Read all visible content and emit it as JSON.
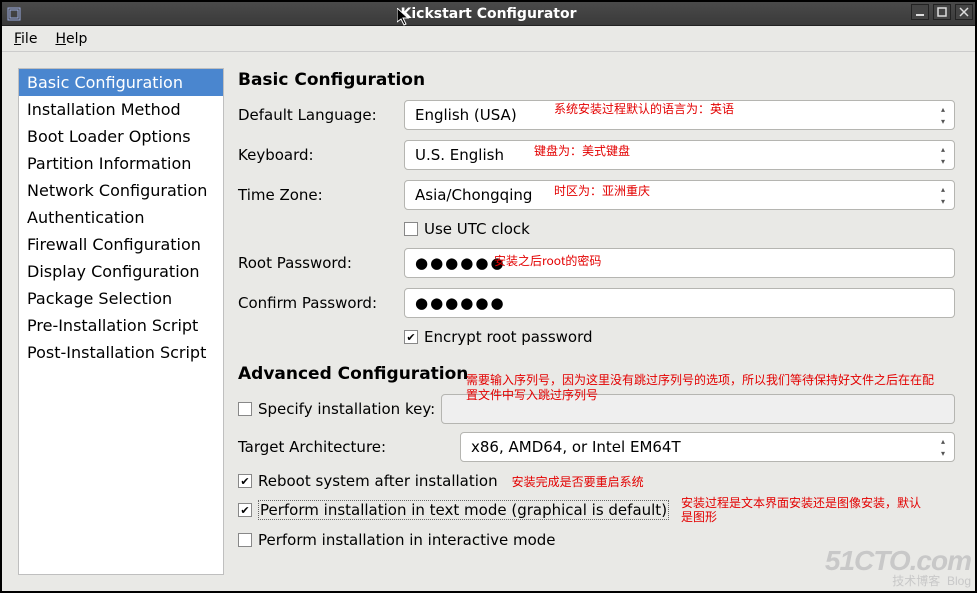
{
  "window": {
    "title": "Kickstart Configurator"
  },
  "menu": {
    "file": "File",
    "help": "Help"
  },
  "sidebar": {
    "items": [
      "Basic Configuration",
      "Installation Method",
      "Boot Loader Options",
      "Partition Information",
      "Network Configuration",
      "Authentication",
      "Firewall Configuration",
      "Display Configuration",
      "Package Selection",
      "Pre-Installation Script",
      "Post-Installation Script"
    ],
    "selected": 0
  },
  "basic": {
    "heading": "Basic Configuration",
    "default_language_label": "Default Language:",
    "default_language_value": "English (USA)",
    "default_language_note": "系统安装过程默认的语言为：英语",
    "keyboard_label": "Keyboard:",
    "keyboard_value": "U.S. English",
    "keyboard_note": "键盘为：美式键盘",
    "timezone_label": "Time Zone:",
    "timezone_value": "Asia/Chongqing",
    "timezone_note": "时区为：亚洲重庆",
    "use_utc_label": "Use UTC clock",
    "use_utc_checked": false,
    "root_pw_label": "Root Password:",
    "root_pw_value": "●●●●●●",
    "root_pw_note": "安装之后root的密码",
    "confirm_pw_label": "Confirm Password:",
    "confirm_pw_value": "●●●●●●",
    "encrypt_label": "Encrypt root password",
    "encrypt_checked": true
  },
  "advanced": {
    "heading": "Advanced Configuration",
    "specify_key_label": "Specify installation key:",
    "specify_key_checked": false,
    "key_value": "",
    "key_note": "需要输入序列号，因为这里没有跳过序列号的选项，所以我们等待保持好文件之后在在配置文件中写入跳过序列号",
    "target_arch_label": "Target Architecture:",
    "target_arch_value": "x86, AMD64, or Intel EM64T",
    "reboot_label": "Reboot system after installation",
    "reboot_checked": true,
    "reboot_note": "安装完成是否要重启系统",
    "textmode_label": "Perform installation in text mode (graphical is default)",
    "textmode_checked": true,
    "textmode_note": "安装过程是文本界面安装还是图像安装，默认是图形",
    "interactive_label": "Perform installation in interactive mode",
    "interactive_checked": false
  },
  "watermark": {
    "big": "51CTO.com",
    "sub1": "技术博客",
    "sub2": "Blog"
  }
}
